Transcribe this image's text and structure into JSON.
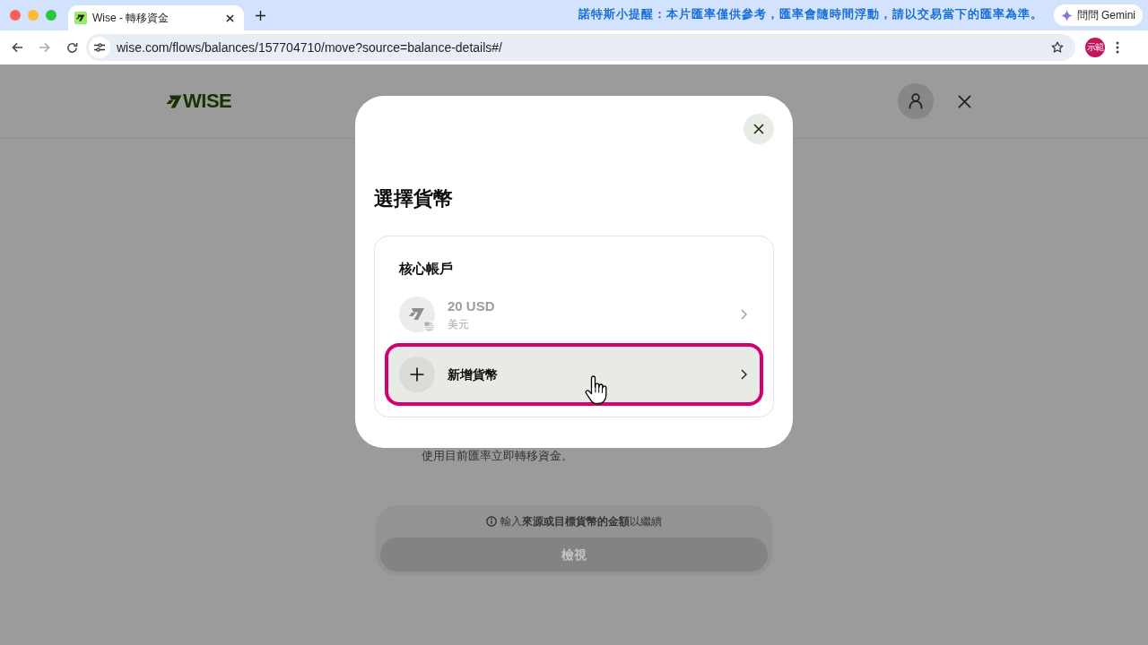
{
  "browser": {
    "tab": {
      "title": "Wise - 轉移資金"
    },
    "notice": "諾特斯小提醒：本片匯率僅供參考，匯率會隨時間浮動，請以交易當下的匯率為準。",
    "gemini_button": "問問 Gemini",
    "url": "wise.com/flows/balances/157704710/move?source=balance-details#/",
    "profile": "示範"
  },
  "header": {
    "logo": "WISE"
  },
  "page": {
    "description": "使用目前匯率立即轉移資金。",
    "hint": "輸入**來源或目標貨幣的金額**以繼續",
    "review_button": {
      "label": "檢視",
      "disabled": true
    }
  },
  "modal": {
    "title": "選擇貨幣",
    "section": {
      "title": "核心帳戶",
      "items": [
        {
          "kind": "balance",
          "amount": "20 USD",
          "currency": "美元",
          "disabled": true,
          "highlighted": false
        },
        {
          "kind": "add",
          "label": "新增貨幣",
          "disabled": false,
          "highlighted": true
        }
      ]
    }
  }
}
